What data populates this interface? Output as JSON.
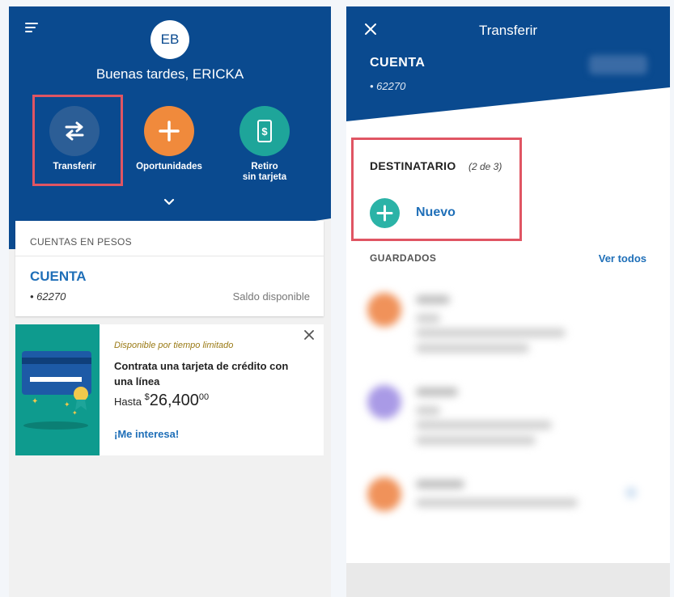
{
  "left": {
    "greeting": "Buenas tardes, ERICKA",
    "avatar_initials": "EB",
    "actions": [
      {
        "label": "Transferir",
        "icon": "transfer-arrows-icon",
        "color": "#2c5e96"
      },
      {
        "label": "Oportunidades",
        "icon": "plus-icon",
        "color": "#f08a3c"
      },
      {
        "label": "Retiro\nsin tarjeta",
        "icon": "phone-cash-icon",
        "color": "#1ea59a"
      }
    ],
    "account_card": {
      "section_label": "CUENTAS EN PESOS",
      "account_name": "CUENTA",
      "account_number": "• 62270",
      "balance_label": "Saldo disponible"
    },
    "promo": {
      "kicker": "Disponible por tiempo limitado",
      "title": "Contrata una tarjeta de crédito con una línea",
      "amount_prefix": "Hasta ",
      "currency": "$",
      "amount": "26,400",
      "cents": "00",
      "cta": "¡Me interesa!"
    }
  },
  "right": {
    "title": "Transferir",
    "account_label": "CUENTA",
    "account_number": "• 62270",
    "recipient_label": "DESTINATARIO",
    "step": "(2 de 3)",
    "new_label": "Nuevo",
    "saved_label": "GUARDADOS",
    "see_all": "Ver todos"
  },
  "colors": {
    "brand_blue": "#0a4a8f",
    "link_blue": "#1f6fb8",
    "highlight_red": "#e05563",
    "teal": "#2bb3a7",
    "orange": "#f08a3c"
  }
}
